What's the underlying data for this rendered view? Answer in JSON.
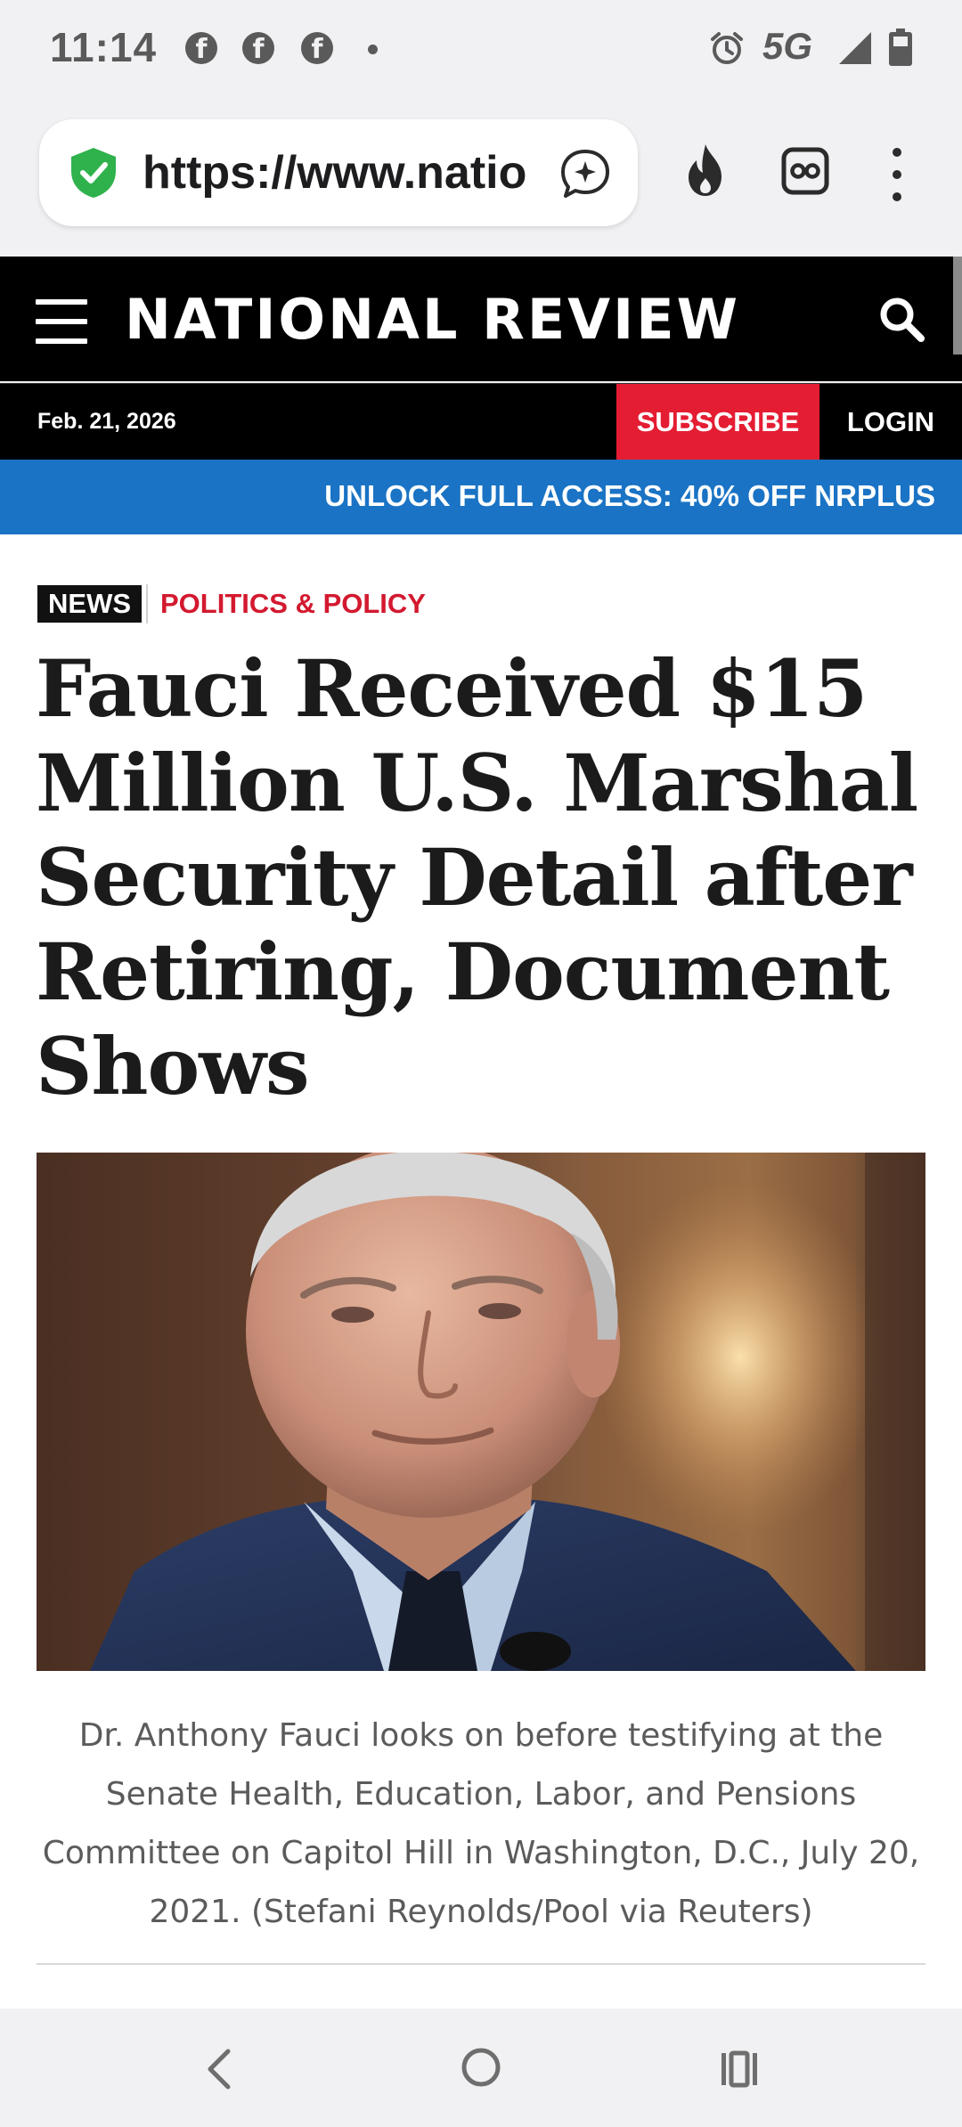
{
  "status_bar": {
    "time": "11:14",
    "notification_icons": [
      "facebook-icon",
      "facebook-icon",
      "facebook-icon"
    ],
    "network": "5G",
    "system_icons": [
      "alarm-icon",
      "signal-icon",
      "battery-icon"
    ]
  },
  "browser": {
    "url": "https://www.nationalreview.com",
    "url_shown": "https://www.natio",
    "icons": [
      "shield-check-icon",
      "assistant-icon",
      "fire-icon",
      "glasses-icon",
      "more-vert-icon"
    ]
  },
  "site": {
    "brand": "NATIONAL REVIEW",
    "date": "Feb. 21, 2026",
    "subscribe_label": "SUBSCRIBE",
    "login_label": "LOGIN",
    "promo": "UNLOCK FULL ACCESS: 40% OFF NRPLUS"
  },
  "article": {
    "tag": "NEWS",
    "category": "POLITICS & POLICY",
    "headline": "Fauci Received $15 Million U.S. Marshal Security Detail after Retiring, Document Shows",
    "caption": "Dr. Anthony Fauci looks on before testifying at the Senate Health, Education, Labor, and Pensions Committee on Capitol Hill in Washington, D.C., July 20, 2021. (Stefani Reynolds/Pool via Reuters)"
  },
  "colors": {
    "brand_red": "#e41d33",
    "promo_blue": "#1a73c4",
    "header_black": "#000000",
    "category_red": "#d3192f"
  }
}
